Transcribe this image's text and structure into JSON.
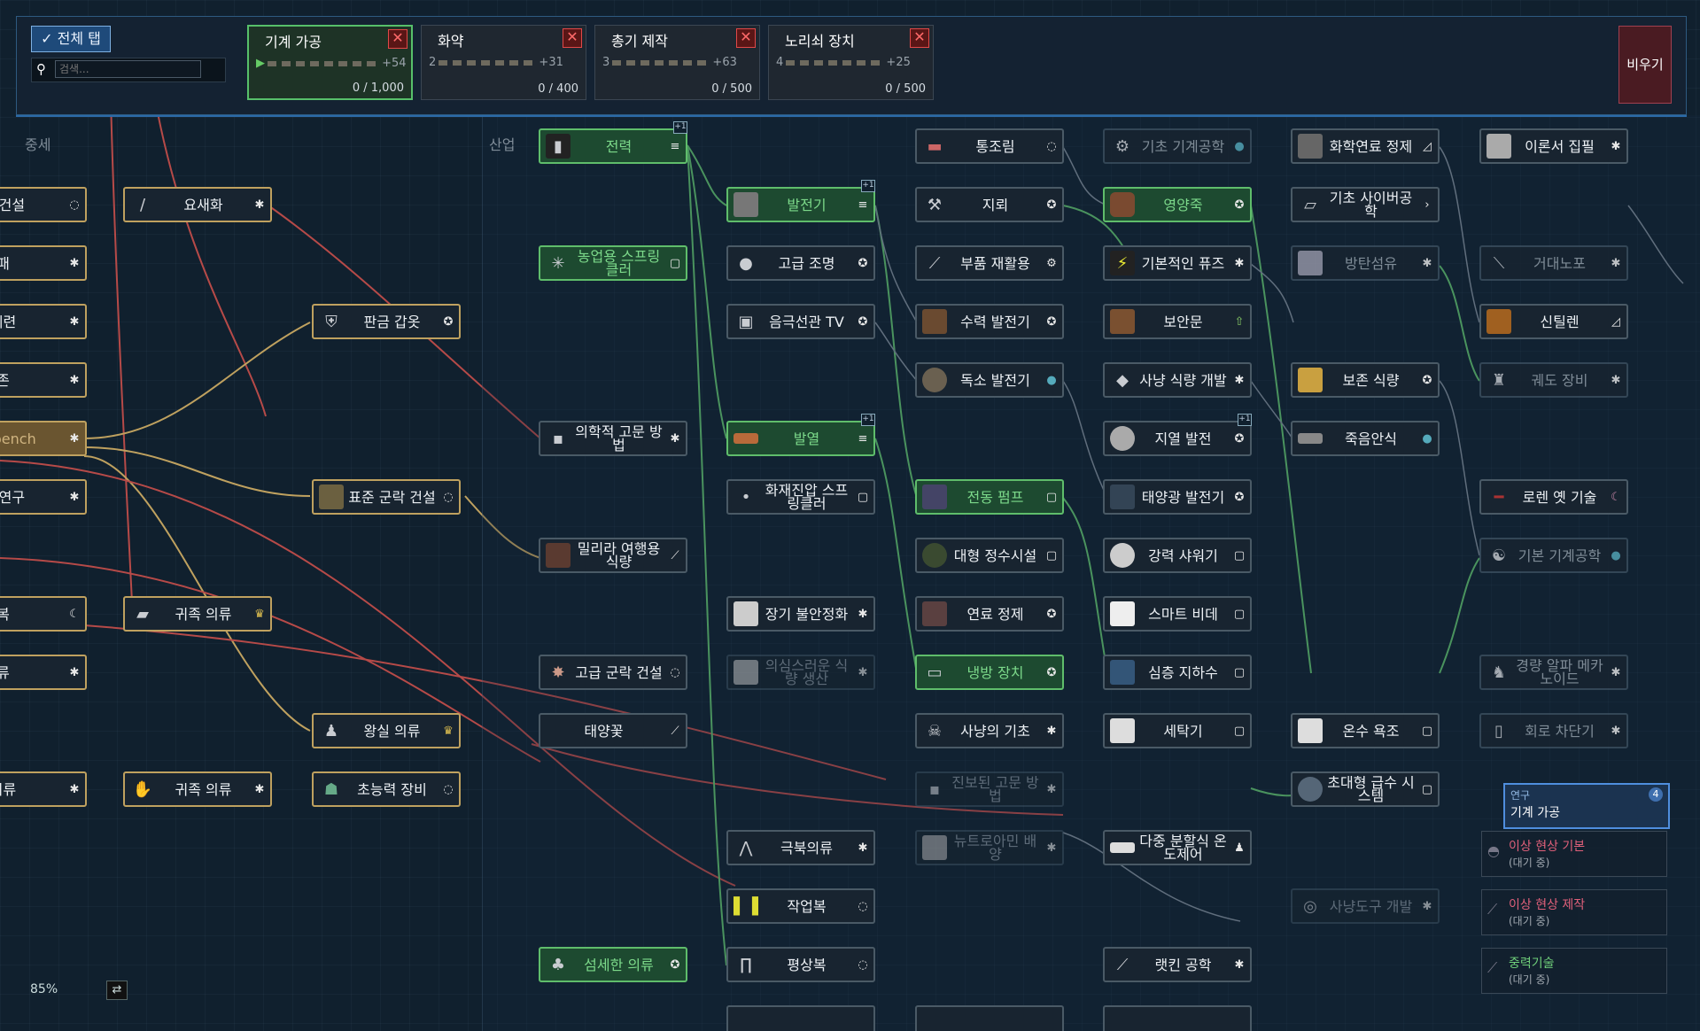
{
  "top_bar": {
    "all_tabs_label": "✓ 전체 탭",
    "search_placeholder": "검색...",
    "clear_label": "비우기",
    "queues": [
      {
        "title": "기계 가공",
        "count": "▶",
        "more": "+54",
        "progress": "0 / 1,000",
        "active": true
      },
      {
        "title": "화약",
        "count": "2",
        "more": "+31",
        "progress": "0 / 400",
        "active": false
      },
      {
        "title": "총기 제작",
        "count": "3",
        "more": "+63",
        "progress": "0 / 500",
        "active": false
      },
      {
        "title": "노리쇠 장치",
        "count": "4",
        "more": "+25",
        "progress": "0 / 500",
        "active": false
      }
    ]
  },
  "tab_headers": {
    "medieval": "중세",
    "industrial": "산업"
  },
  "nodes": {
    "c0": [
      "락 건설",
      "패",
      "제련",
      "존",
      "ng bench",
      "석 연구",
      "복",
      "류",
      "의류"
    ],
    "c1": [
      "요새화",
      "귀족 의류",
      "귀족 의류"
    ],
    "c2": [
      "판금 갑옷",
      "표준 군락 건설",
      "왕실 의류",
      "초능력 장비"
    ],
    "c3": [
      "전력",
      "농업용 스프링클러",
      "의학적 고문 방법",
      "밀리라 여행용 식량",
      "고급 군락 건설",
      "태양꽃",
      "섬세한 의류"
    ],
    "c4": [
      "발전기",
      "고급 조명",
      "음극선관 TV",
      "발열",
      "화재진압 스프링클러",
      "장기 불안정화",
      "의심스러운 식량 생산",
      "극북의류",
      "작업복",
      "평상복"
    ],
    "c5": [
      "통조림",
      "지뢰",
      "부품 재활용",
      "수력 발전기",
      "독소 발전기",
      "전동 펌프",
      "대형 정수시설",
      "연료 정제",
      "냉방 장치",
      "사냥의 기초",
      "진보된 고문 방법",
      "뉴트로아민 배양"
    ],
    "c6": [
      "기초 기계공학",
      "영양죽",
      "기본적인 퓨즈",
      "보안문",
      "사냥 식량 개발",
      "지열 발전",
      "태양광 발전기",
      "강력 샤워기",
      "스마트 비데",
      "심층 지하수",
      "세탁기",
      "다중 분할식 온도제어",
      "랫킨 공학"
    ],
    "c7": [
      "화학연료 정제",
      "기초 사이버공학",
      "방탄섬유",
      "보존 식량",
      "죽음안식",
      "온수 욕조",
      "초대형 급수 시스템",
      "사냥도구 개발"
    ],
    "c8": [
      "이론서 집필",
      "거대노포",
      "신틸렌",
      "궤도 장비",
      "로렌 옛 기술",
      "기본 기계공학",
      "경량 알파 메카노이드",
      "회로 차단기"
    ]
  },
  "research_popup": {
    "label": "연구",
    "name": "기계 가공",
    "count": "4"
  },
  "queued": [
    {
      "name": "이상 현상 기본",
      "status": "(대기 중)"
    },
    {
      "name": "이상 현상 제작",
      "status": "(대기 중)"
    },
    {
      "name": "중력기술",
      "status": "(대기 중)"
    }
  ],
  "zoom_label": "85%",
  "colors": {
    "accent": "#2b6aa8",
    "done": "#5fbd6b",
    "gold": "#bfa15f",
    "cancel": "#e14848"
  }
}
